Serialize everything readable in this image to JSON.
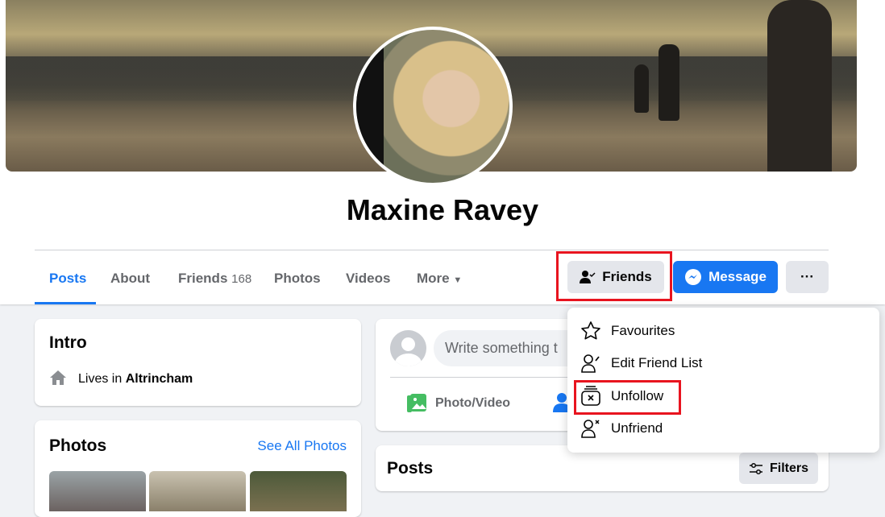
{
  "profile": {
    "name": "Maxine Ravey"
  },
  "tabs": [
    {
      "label": "Posts"
    },
    {
      "label": "About"
    },
    {
      "label": "Friends",
      "count": "168"
    },
    {
      "label": "Photos"
    },
    {
      "label": "Videos"
    },
    {
      "label": "More"
    }
  ],
  "actions": {
    "friends": "Friends",
    "message": "Message",
    "more": "···"
  },
  "menu": {
    "items": [
      {
        "label": "Favourites"
      },
      {
        "label": "Edit Friend List"
      },
      {
        "label": "Unfollow"
      },
      {
        "label": "Unfriend"
      }
    ]
  },
  "intro": {
    "title": "Intro",
    "lives_prefix": "Lives in",
    "city": "Altrincham"
  },
  "photos": {
    "title": "Photos",
    "see_all": "See All Photos"
  },
  "composer": {
    "placeholder": "Write something t",
    "photo_video": "Photo/Video"
  },
  "posts": {
    "title": "Posts",
    "filters": "Filters"
  },
  "colors": {
    "accent": "#1877f2",
    "highlight": "#e8141f"
  }
}
